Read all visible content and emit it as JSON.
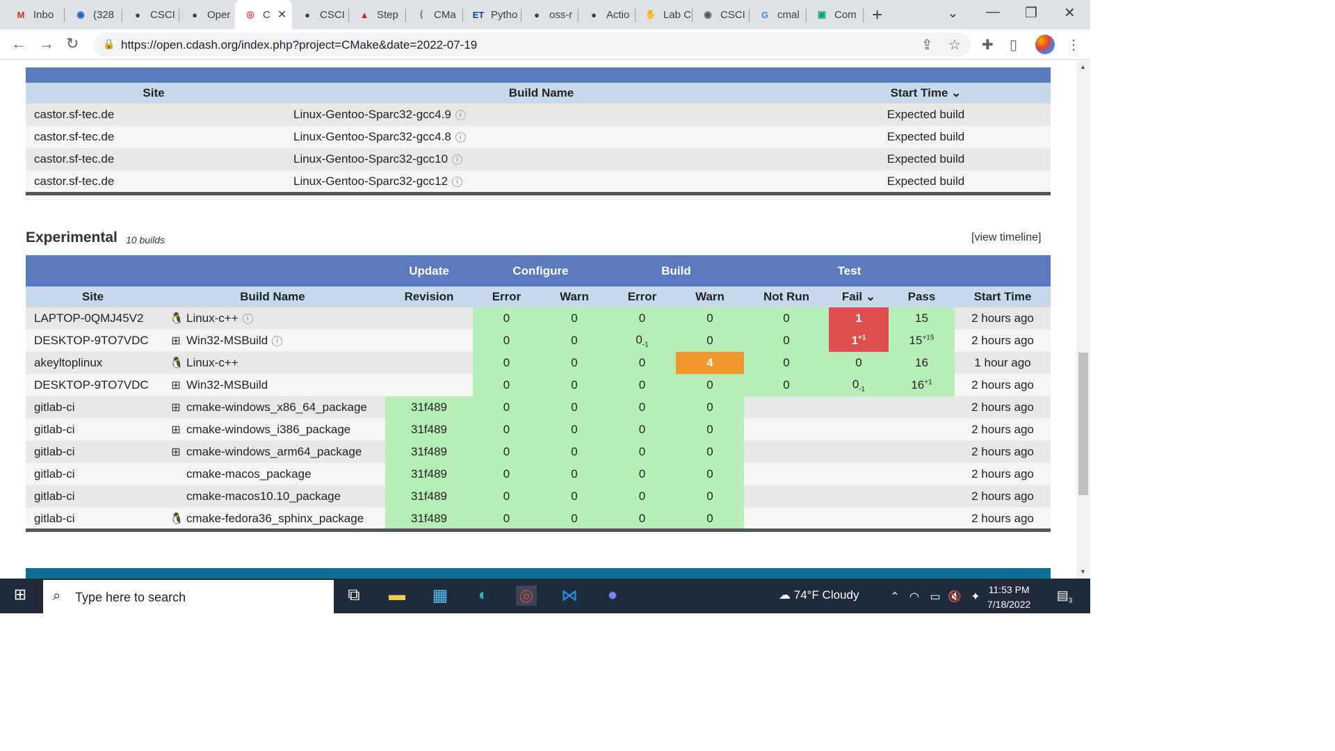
{
  "browser": {
    "tabs": [
      "Inbo",
      "(328",
      "CSCI",
      "Oper",
      "C",
      "CSCI",
      "Step",
      "CMa",
      "Pytho",
      "oss-r",
      "Actio",
      "Lab C",
      "CSCI",
      "cmal",
      "Com"
    ],
    "url": "https://open.cdash.org/index.php?project=CMake&date=2022-07-19"
  },
  "expected": {
    "headers": {
      "site": "Site",
      "build_name": "Build Name",
      "start_time": "Start Time"
    },
    "rows": [
      {
        "site": "castor.sf-tec.de",
        "build": "Linux-Gentoo-Sparc32-gcc4.9",
        "time": "Expected build"
      },
      {
        "site": "castor.sf-tec.de",
        "build": "Linux-Gentoo-Sparc32-gcc4.8",
        "time": "Expected build"
      },
      {
        "site": "castor.sf-tec.de",
        "build": "Linux-Gentoo-Sparc32-gcc10",
        "time": "Expected build"
      },
      {
        "site": "castor.sf-tec.de",
        "build": "Linux-Gentoo-Sparc32-gcc12",
        "time": "Expected build"
      }
    ]
  },
  "experimental": {
    "title": "Experimental",
    "count": "10 builds",
    "timeline": "[view timeline]",
    "groups": {
      "update": "Update",
      "configure": "Configure",
      "build": "Build",
      "test": "Test"
    },
    "headers": {
      "site": "Site",
      "build_name": "Build Name",
      "revision": "Revision",
      "cfg_error": "Error",
      "cfg_warn": "Warn",
      "bld_error": "Error",
      "bld_warn": "Warn",
      "not_run": "Not Run",
      "fail": "Fail",
      "pass": "Pass",
      "start_time": "Start Time"
    },
    "rows": [
      {
        "site": "LAPTOP-0QMJ45V2",
        "os": "linux",
        "build": "Linux-c++",
        "revision": "",
        "cfg_error": "0",
        "cfg_warn": "0",
        "bld_error": "0",
        "bld_warn": "0",
        "not_run": "0",
        "fail": "1",
        "pass": "15",
        "time": "2 hours ago"
      },
      {
        "site": "DESKTOP-9TO7VDC",
        "os": "windows",
        "build": "Win32-MSBuild",
        "revision": "",
        "cfg_error": "0",
        "cfg_warn": "0",
        "bld_error": "0",
        "bld_error_delta": "-1",
        "bld_warn": "0",
        "not_run": "0",
        "fail": "1",
        "fail_delta": "+1",
        "pass": "15",
        "pass_delta": "+15",
        "time": "2 hours ago"
      },
      {
        "site": "akeyltoplinux",
        "os": "linux",
        "build": "Linux-c++",
        "revision": "",
        "cfg_error": "0",
        "cfg_warn": "0",
        "bld_error": "0",
        "bld_warn": "4",
        "not_run": "0",
        "fail": "0",
        "pass": "16",
        "time": "1 hour ago"
      },
      {
        "site": "DESKTOP-9TO7VDC",
        "os": "windows",
        "build": "Win32-MSBuild",
        "revision": "",
        "cfg_error": "0",
        "cfg_warn": "0",
        "bld_error": "0",
        "bld_warn": "0",
        "not_run": "0",
        "fail": "0",
        "fail_delta": "-1",
        "pass": "16",
        "pass_delta": "+1",
        "time": "2 hours ago"
      },
      {
        "site": "gitlab-ci",
        "os": "windows",
        "build": "cmake-windows_x86_64_package",
        "revision": "31f489",
        "cfg_error": "0",
        "cfg_warn": "0",
        "bld_error": "0",
        "bld_warn": "0",
        "time": "2 hours ago"
      },
      {
        "site": "gitlab-ci",
        "os": "windows",
        "build": "cmake-windows_i386_package",
        "revision": "31f489",
        "cfg_error": "0",
        "cfg_warn": "0",
        "bld_error": "0",
        "bld_warn": "0",
        "time": "2 hours ago"
      },
      {
        "site": "gitlab-ci",
        "os": "windows",
        "build": "cmake-windows_arm64_package",
        "revision": "31f489",
        "cfg_error": "0",
        "cfg_warn": "0",
        "bld_error": "0",
        "bld_warn": "0",
        "time": "2 hours ago"
      },
      {
        "site": "gitlab-ci",
        "os": "apple",
        "build": "cmake-macos_package",
        "revision": "31f489",
        "cfg_error": "0",
        "cfg_warn": "0",
        "bld_error": "0",
        "bld_warn": "0",
        "time": "2 hours ago"
      },
      {
        "site": "gitlab-ci",
        "os": "apple",
        "build": "cmake-macos10.10_package",
        "revision": "31f489",
        "cfg_error": "0",
        "cfg_warn": "0",
        "bld_error": "0",
        "bld_warn": "0",
        "time": "2 hours ago"
      },
      {
        "site": "gitlab-ci",
        "os": "linux",
        "build": "cmake-fedora36_sphinx_package",
        "revision": "31f489",
        "cfg_error": "0",
        "cfg_warn": "0",
        "bld_error": "0",
        "bld_warn": "0",
        "time": "2 hours ago"
      }
    ]
  },
  "taskbar": {
    "search_placeholder": "Type here to search",
    "weather": "74°F  Cloudy",
    "time": "11:53 PM",
    "date": "7/18/2022",
    "notification_count": "3"
  }
}
